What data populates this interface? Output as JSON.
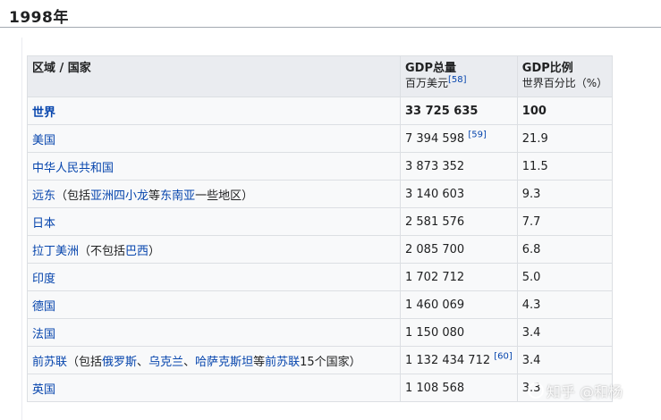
{
  "section": {
    "title": "1998年"
  },
  "table": {
    "headers": {
      "region": "区域 / 国家",
      "gdp": "GDP总量",
      "gdp_unit": "百万美元",
      "gdp_ref": "[58]",
      "share": "GDP比例",
      "share_unit": "世界百分比（%）"
    },
    "world": {
      "name": "世界",
      "gdp": "33 725 635",
      "share": "100"
    },
    "usa": {
      "name": "美国",
      "gdp": "7 394 598",
      "ref": "[59]",
      "share": "21.9"
    },
    "china": {
      "name": "中华人民共和国",
      "gdp": "3 873 352",
      "share": "11.5"
    },
    "fareast": {
      "name": "远东",
      "p1": "（包括",
      "link1": "亚洲四小龙",
      "p2": "等",
      "link2": "东南亚",
      "p3": "一些地区）",
      "gdp": "3 140 603",
      "share": "9.3"
    },
    "japan": {
      "name": "日本",
      "gdp": "2 581 576",
      "share": "7.7"
    },
    "latam": {
      "name": "拉丁美洲",
      "p1": "（不包括",
      "link1": "巴西",
      "p2": "）",
      "gdp": "2 085 700",
      "share": "6.8"
    },
    "india": {
      "name": "印度",
      "gdp": "1 702 712",
      "share": "5.0"
    },
    "germany": {
      "name": "德国",
      "gdp": "1 460 069",
      "share": "4.3"
    },
    "france": {
      "name": "法国",
      "gdp": "1 150 080",
      "share": "3.4"
    },
    "ussr": {
      "name": "前苏联",
      "p1": "（包括",
      "link1": "俄罗斯",
      "sep1": "、",
      "link2": "乌克兰",
      "sep2": "、",
      "link3": "哈萨克斯坦",
      "p2": "等",
      "link4": "前苏联",
      "p3": "15个国家）",
      "gdp": "1 132 434 712",
      "ref": "[60]",
      "share": "3.4"
    },
    "uk": {
      "name": "英国",
      "gdp": "1 108 568",
      "share": "3.3"
    }
  },
  "watermark": "知乎 @和杨"
}
